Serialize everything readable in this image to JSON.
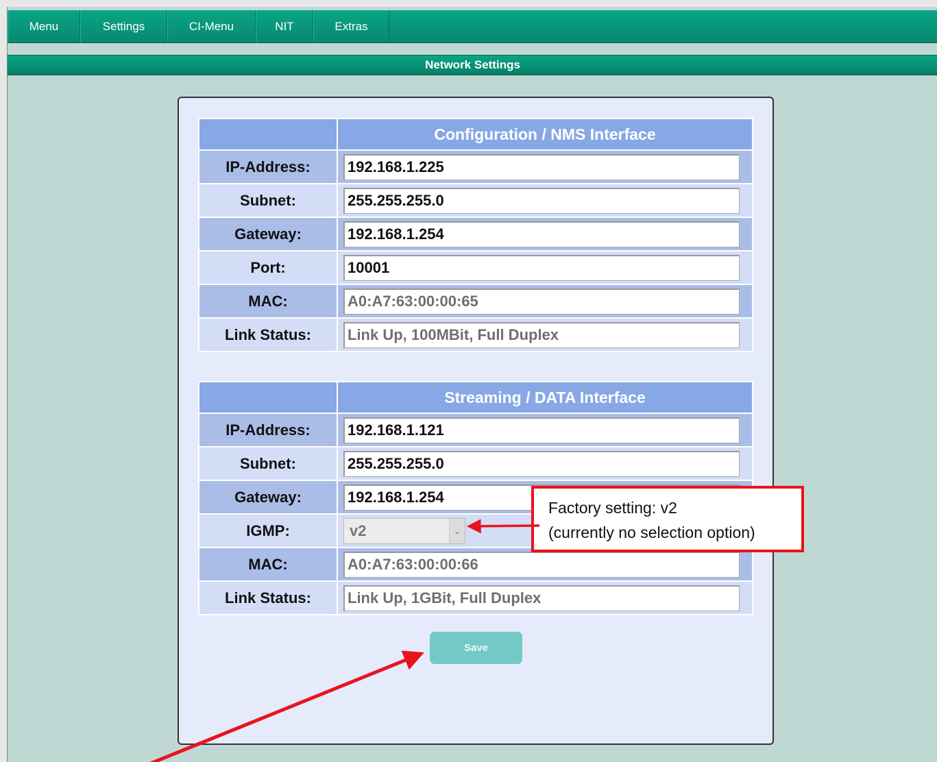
{
  "nav": {
    "items": [
      "Menu",
      "Settings",
      "CI-Menu",
      "NIT",
      "Extras"
    ]
  },
  "section_title": "Network Settings",
  "config": {
    "title": "Configuration / NMS Interface",
    "rows": [
      {
        "label": "IP-Address:",
        "value": "192.168.1.225",
        "editable": true
      },
      {
        "label": "Subnet:",
        "value": "255.255.255.0",
        "editable": true
      },
      {
        "label": "Gateway:",
        "value": "192.168.1.254",
        "editable": true
      },
      {
        "label": "Port:",
        "value": "10001",
        "editable": true
      },
      {
        "label": "MAC:",
        "value": "A0:A7:63:00:00:65",
        "editable": false
      },
      {
        "label": "Link Status:",
        "value": "Link Up, 100MBit, Full Duplex",
        "editable": false
      }
    ]
  },
  "streaming": {
    "title": "Streaming / DATA Interface",
    "rows": [
      {
        "label": "IP-Address:",
        "value": "192.168.1.121",
        "editable": true
      },
      {
        "label": "Subnet:",
        "value": "255.255.255.0",
        "editable": true
      },
      {
        "label": "Gateway:",
        "value": "192.168.1.254",
        "editable": true
      },
      {
        "label": "IGMP:",
        "value": "v2",
        "editable": false
      },
      {
        "label": "MAC:",
        "value": "A0:A7:63:00:00:66",
        "editable": false
      },
      {
        "label": "Link Status:",
        "value": "Link Up, 1GBit, Full Duplex",
        "editable": false
      }
    ]
  },
  "save_label": "Save",
  "annotation": {
    "line1": "Factory setting: v2",
    "line2": "(currently no selection option)",
    "color": "#e8141c"
  },
  "colors": {
    "nav": "#06896f",
    "background": "#c0d8d4",
    "header": "#87a7e5",
    "save": "#73c9c6"
  }
}
